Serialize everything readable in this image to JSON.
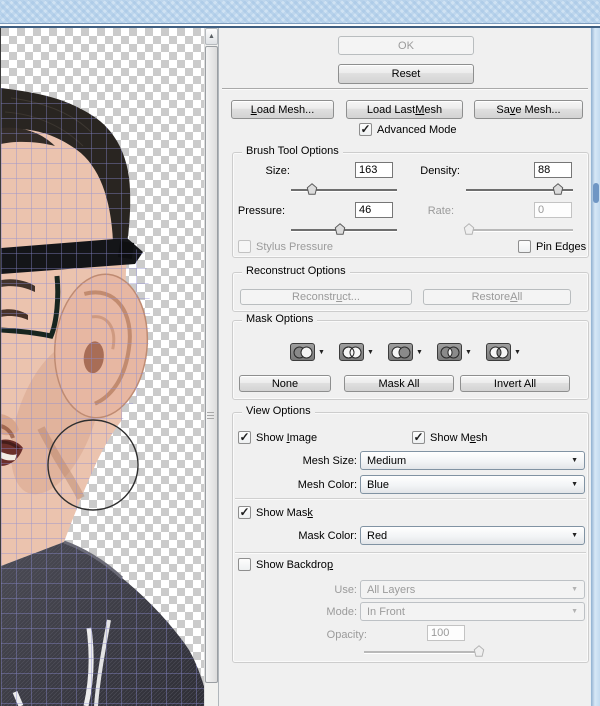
{
  "titlebar": {},
  "dialog": {
    "ok_label": "OK",
    "reset_label": "Reset",
    "load_mesh": {
      "text": "Load Mesh...",
      "u": 0
    },
    "load_last_mesh": {
      "text": "Load Last Mesh",
      "u": 10
    },
    "save_mesh": {
      "text": "Save Mesh...",
      "u": 2
    },
    "advanced_mode": {
      "label": {
        "text": "Advanced Mode",
        "u": -1
      },
      "checked": true
    }
  },
  "brush": {
    "title": "Brush Tool Options",
    "size": {
      "label": "Size:",
      "value": "163",
      "percent": 20
    },
    "density": {
      "label": "Density:",
      "value": "88",
      "percent": 86
    },
    "pressure": {
      "label": "Pressure:",
      "value": "46",
      "percent": 46
    },
    "rate": {
      "label": "Rate:",
      "value": "0",
      "percent": 3,
      "disabled": true
    },
    "stylus_pressure": {
      "label": {
        "text": "Stylus Pressure",
        "u": -1
      },
      "checked": false,
      "disabled": true
    },
    "pin_edges": {
      "label": {
        "text": "Pin Edges",
        "u": -1
      },
      "checked": false
    }
  },
  "reconstruct": {
    "title": "Reconstruct Options",
    "reconstruct_button": {
      "text": "Reconstruct...",
      "u": 8
    },
    "restore_all_button": {
      "text": "Restore All",
      "u": 8
    }
  },
  "mask": {
    "title": "Mask Options",
    "tools": [
      "replace-selection",
      "add-to-selection",
      "subtract-from-selection",
      "intersect-with-selection",
      "invert-selection"
    ],
    "none_button": "None",
    "mask_all_button": "Mask All",
    "invert_all_button": "Invert All"
  },
  "view": {
    "title": "View Options",
    "show_image": {
      "label": {
        "text": "Show Image",
        "u": 5
      },
      "checked": true
    },
    "show_mesh": {
      "label": {
        "text": "Show Mesh",
        "u": 6
      },
      "checked": true
    },
    "mesh_size": {
      "label": "Mesh Size:",
      "value": "Medium"
    },
    "mesh_color": {
      "label": "Mesh Color:",
      "value": "Blue"
    },
    "show_mask": {
      "label": {
        "text": "Show Mask",
        "u": 8
      },
      "checked": true
    },
    "mask_color": {
      "label": "Mask Color:",
      "value": "Red"
    },
    "show_backdrop": {
      "label": {
        "text": "Show Backdrop",
        "u": 12
      },
      "checked": false
    },
    "use": {
      "label": "Use:",
      "value": "All Layers",
      "disabled": true
    },
    "mode": {
      "label": "Mode:",
      "value": "In Front",
      "disabled": true
    },
    "opacity": {
      "label": "Opacity:",
      "value": "100",
      "percent": 97,
      "disabled": true
    }
  },
  "colors": {
    "mesh_line": "#8c8cd2",
    "panel_bg": "#f0f0f0",
    "titlebar_blue": "#cfe2f3",
    "disabled_text": "#9a9a9a"
  }
}
